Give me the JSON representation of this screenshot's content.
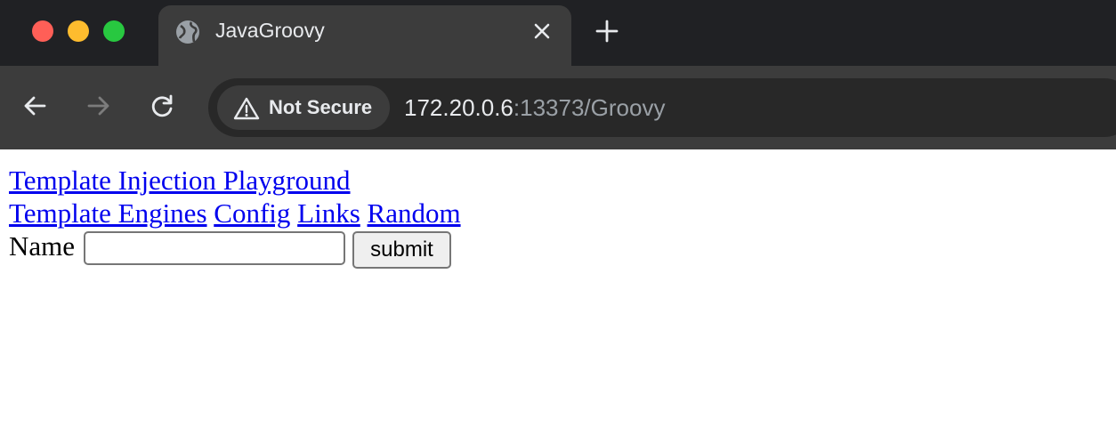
{
  "browser": {
    "tab": {
      "title": "JavaGroovy",
      "favicon": "globe-icon"
    },
    "security_chip": {
      "label": "Not Secure",
      "icon": "warning-triangle-icon"
    },
    "address": {
      "host": "172.20.0.6",
      "rest": ":13373/Groovy"
    },
    "colors": {
      "tabstrip": "#202124",
      "toolbar": "#3c3c3c",
      "omnibox": "#282828",
      "close": "#ff5f57",
      "minimize": "#febc2e",
      "maximize": "#28c840"
    }
  },
  "page": {
    "title_link": "Template Injection Playground",
    "nav_links": [
      "Template Engines",
      "Config",
      "Links",
      "Random"
    ],
    "form": {
      "label": "Name",
      "input_value": "",
      "submit_label": "submit"
    },
    "link_color": "#0000ee"
  }
}
